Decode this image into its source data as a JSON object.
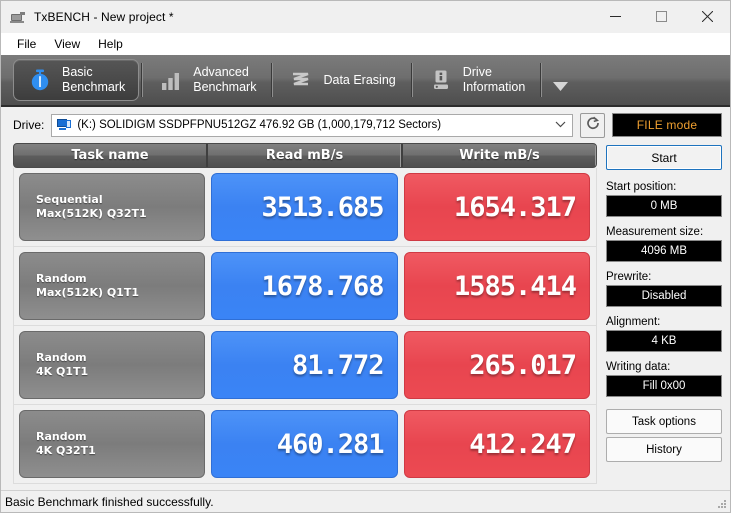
{
  "window": {
    "title": "TxBENCH - New project *",
    "icon": "app-icon",
    "minimize": "minimize",
    "maximize": "maximize",
    "close": "close"
  },
  "menu": {
    "items": [
      {
        "label": "File"
      },
      {
        "label": "View"
      },
      {
        "label": "Help"
      }
    ]
  },
  "tabs": {
    "items": [
      {
        "line1": "Basic",
        "line2": "Benchmark",
        "icon": "stopwatch-icon",
        "active": true
      },
      {
        "line1": "Advanced",
        "line2": "Benchmark",
        "icon": "bar-chart-icon",
        "active": false
      },
      {
        "line1": "Data Erasing",
        "line2": "",
        "icon": "eraser-wave-icon",
        "active": false
      },
      {
        "line1": "Drive",
        "line2": "Information",
        "icon": "drive-info-icon",
        "active": false
      }
    ],
    "overflow_icon": "chevron-down-icon"
  },
  "drive": {
    "label": "Drive:",
    "icon": "drive-icon",
    "selected": "(K:) SOLIDIGM SSDPFPNU512GZ  476.92 GB (1,000,179,712 Sectors)",
    "dropdown_icon": "chevron-down-icon",
    "refresh_icon": "refresh-icon",
    "mode_label": "FILE mode"
  },
  "results": {
    "headers": {
      "task": "Task name",
      "read": "Read mB/s",
      "write": "Write mB/s"
    },
    "rows": [
      {
        "name_line1": "Sequential",
        "name_line2": "Max(512K) Q32T1",
        "read": "3513.685",
        "write": "1654.317"
      },
      {
        "name_line1": "Random",
        "name_line2": "Max(512K) Q1T1",
        "read": "1678.768",
        "write": "1585.414"
      },
      {
        "name_line1": "Random",
        "name_line2": "4K Q1T1",
        "read": "81.772",
        "write": "265.017"
      },
      {
        "name_line1": "Random",
        "name_line2": "4K Q32T1",
        "read": "460.281",
        "write": "412.247"
      }
    ]
  },
  "panel": {
    "start_button": "Start",
    "fields": [
      {
        "label": "Start position:",
        "value": "0 MB"
      },
      {
        "label": "Measurement size:",
        "value": "4096 MB"
      },
      {
        "label": "Prewrite:",
        "value": "Disabled"
      },
      {
        "label": "Alignment:",
        "value": "4 KB"
      },
      {
        "label": "Writing data:",
        "value": "Fill 0x00"
      }
    ],
    "task_options_button": "Task options",
    "history_button": "History"
  },
  "status": {
    "text": "Basic Benchmark finished successfully."
  },
  "colors": {
    "read_blue": "#3a84f6",
    "write_red": "#ec4a52",
    "accent_blue": "#1e73be",
    "mode_orange": "#f0a030",
    "tab_dark": "#5e5e5e"
  }
}
